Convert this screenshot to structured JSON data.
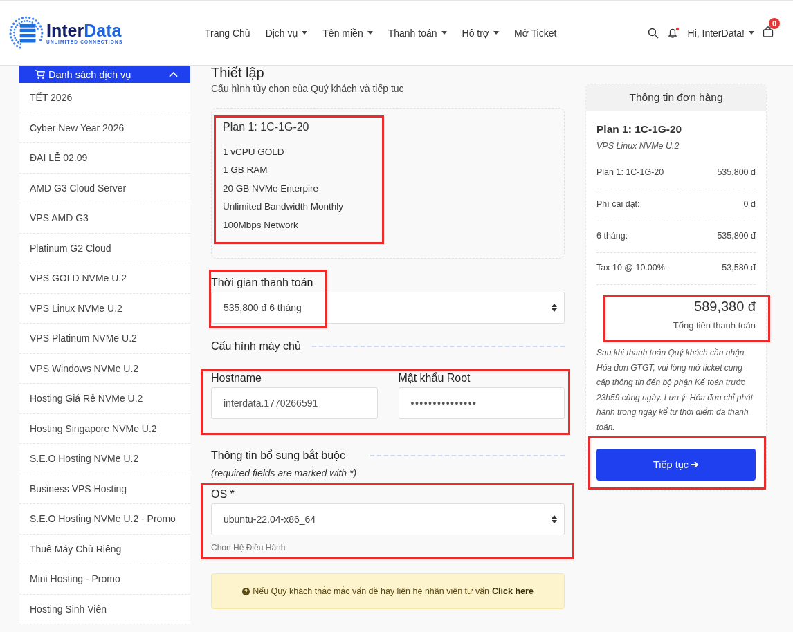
{
  "header": {
    "logo": {
      "first": "Inter",
      "second": "Data",
      "tagline": "UNLIMITED CONNECTIONS"
    },
    "nav": [
      {
        "label": "Trang Chủ",
        "dropdown": false
      },
      {
        "label": "Dịch vụ",
        "dropdown": true
      },
      {
        "label": "Tên miền",
        "dropdown": true
      },
      {
        "label": "Thanh toán",
        "dropdown": true
      },
      {
        "label": "Hỗ trợ",
        "dropdown": true
      },
      {
        "label": "Mở Ticket",
        "dropdown": false
      }
    ],
    "user": "Hi, InterData!",
    "cart_count": "0"
  },
  "sidebar": {
    "title": "Danh sách dịch vụ",
    "items": [
      "TẾT 2026",
      "Cyber New Year 2026",
      "ĐẠI LỄ 02.09",
      "AMD G3 Cloud Server",
      "VPS AMD G3",
      "Platinum G2 Cloud",
      "VPS GOLD NVMe U.2",
      "VPS Linux NVMe U.2",
      "VPS Platinum NVMe U.2",
      "VPS Windows NVMe U.2",
      "Hosting Giá Rẻ NVMe U.2",
      "Hosting Singapore NVMe U.2",
      "S.E.O Hosting NVMe U.2",
      "Business VPS Hosting",
      "S.E.O Hosting NVMe U.2 - Promo",
      "Thuê Máy Chủ Riêng",
      "Mini Hosting - Promo",
      "Hosting Sinh Viên"
    ]
  },
  "configure": {
    "title": "Thiết lập",
    "subtitle": "Cấu hình tùy chọn của Quý khách và tiếp tục",
    "plan": {
      "name": "Plan 1: 1C-1G-20",
      "features": [
        "1 vCPU GOLD",
        "1 GB RAM",
        "20 GB NVMe Enterpire",
        "Unlimited Bandwidth Monthly",
        "100Mbps Network"
      ]
    },
    "billing": {
      "label": "Thời gian thanh toán",
      "value": "535,800 đ 6 tháng"
    },
    "server_section": "Cấu hình máy chủ",
    "hostname": {
      "label": "Hostname",
      "value": "interdata.1770266591"
    },
    "root_password": {
      "label": "Mật khẩu Root",
      "value": "•••••••••••••••"
    },
    "extra_section": {
      "title": "Thông tin bổ sung bắt buộc",
      "note": "(required fields are marked with *)"
    },
    "os": {
      "label": "OS *",
      "value": "ubuntu-22.04-x86_64",
      "help": "Chọn Hệ Điều Hành"
    },
    "notice": {
      "text": "Nếu Quý khách thắc mắc vấn đề hãy liên hệ nhân viên tư vấn",
      "link": "Click here"
    }
  },
  "summary": {
    "title": "Thông tin đơn hàng",
    "plan": "Plan 1: 1C-1G-20",
    "product": "VPS Linux NVMe U.2",
    "lines": [
      {
        "label": "Plan 1: 1C-1G-20",
        "value": "535,800 đ"
      },
      {
        "label": "Phí cài đặt:",
        "value": "0 đ"
      },
      {
        "label": "6 tháng:",
        "value": "535,800 đ"
      },
      {
        "label": "Tax 10 @ 10.00%:",
        "value": "53,580 đ"
      }
    ],
    "total": "589,380 đ",
    "total_label": "Tổng tiền thanh toán",
    "note": "Sau khi thanh toán Quý khách cần nhận Hóa đơn GTGT, vui lòng mở ticket cung cấp thông tin đến bộ phận Kế toán trước 23h59 cùng ngày. Lưu ý: Hóa đơn chỉ phát hành trong ngày kể từ thời điểm đã thanh toán.",
    "button": "Tiếp tục"
  }
}
